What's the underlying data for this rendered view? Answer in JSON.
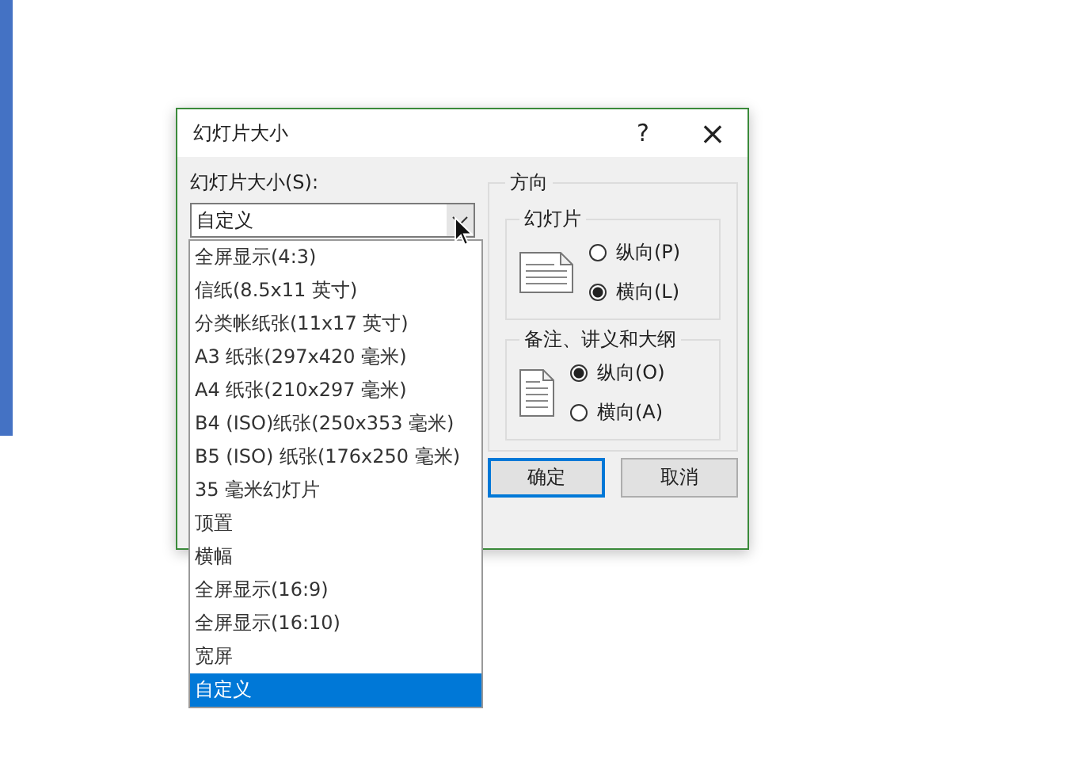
{
  "dialog": {
    "title": "幻灯片大小",
    "help": "?",
    "close": "×"
  },
  "size": {
    "label": "幻灯片大小(S):",
    "value": "自定义",
    "options": [
      {
        "label": "全屏显示(4:3)",
        "selected": false
      },
      {
        "label": "信纸(8.5x11 英寸)",
        "selected": false
      },
      {
        "label": "分类帐纸张(11x17 英寸)",
        "selected": false
      },
      {
        "label": "A3 纸张(297x420 毫米)",
        "selected": false
      },
      {
        "label": "A4 纸张(210x297 毫米)",
        "selected": false
      },
      {
        "label": "B4 (ISO)纸张(250x353 毫米)",
        "selected": false
      },
      {
        "label": "B5 (ISO) 纸张(176x250 毫米)",
        "selected": false
      },
      {
        "label": "35 毫米幻灯片",
        "selected": false
      },
      {
        "label": "顶置",
        "selected": false
      },
      {
        "label": "横幅",
        "selected": false
      },
      {
        "label": "全屏显示(16:9)",
        "selected": false
      },
      {
        "label": "全屏显示(16:10)",
        "selected": false
      },
      {
        "label": "宽屏",
        "selected": false
      },
      {
        "label": "自定义",
        "selected": true
      }
    ]
  },
  "orientation": {
    "title": "方向",
    "groups": [
      {
        "title": "幻灯片",
        "kind": "landscape",
        "options": [
          {
            "label": "纵向(P)",
            "selected": false
          },
          {
            "label": "横向(L)",
            "selected": true
          }
        ]
      },
      {
        "title": "备注、讲义和大纲",
        "kind": "portrait",
        "options": [
          {
            "label": "纵向(O)",
            "selected": true
          },
          {
            "label": "横向(A)",
            "selected": false
          }
        ]
      }
    ]
  },
  "buttons": [
    {
      "label": "确定",
      "default": true
    },
    {
      "label": "取消",
      "default": false
    }
  ]
}
